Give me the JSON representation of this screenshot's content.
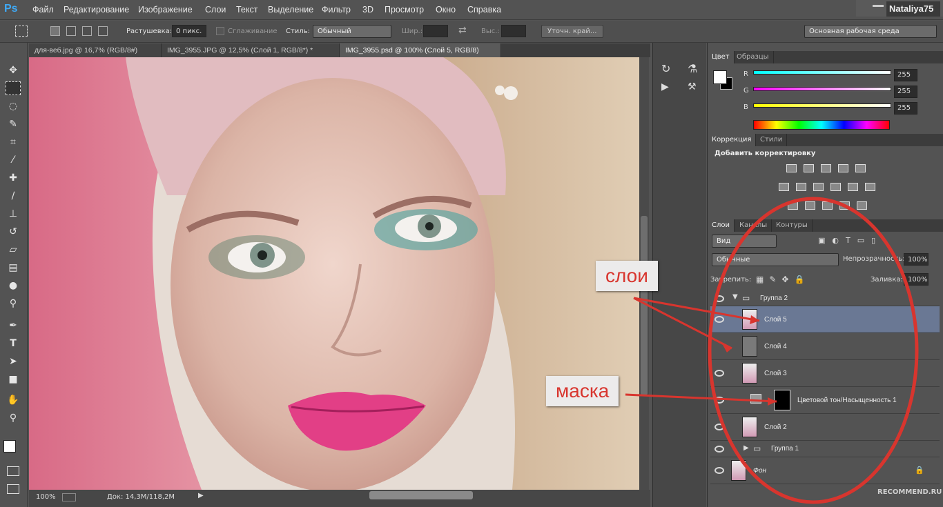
{
  "app": {
    "logo": "Ps",
    "user": "Nataliya75"
  },
  "menu": [
    "Файл",
    "Редактирование",
    "Изображение",
    "Слои",
    "Текст",
    "Выделение",
    "Фильтр",
    "3D",
    "Просмотр",
    "Окно",
    "Справка"
  ],
  "options": {
    "feather_label": "Растушевка:",
    "feather_value": "0 пикс.",
    "antialias_label": "Сглаживание",
    "style_label": "Стиль:",
    "style_value": "Обычный",
    "width_label": "Шир.:",
    "height_label": "Выс.:",
    "refine_button": "Уточн. край...",
    "workspace": "Основная рабочая среда"
  },
  "tabs": [
    {
      "label": "для-веб.jpg @ 16,7% (RGB/8#)"
    },
    {
      "label": "IMG_3955.JPG @ 12,5% (Слой 1, RGB/8*) *"
    },
    {
      "label": "IMG_3955.psd @ 100% (Слой 5, RGB/8)"
    }
  ],
  "status": {
    "zoom": "100%",
    "doc": "Док: 14,3M/118,2M"
  },
  "color_panel": {
    "tab_color": "Цвет",
    "tab_swatches": "Образцы",
    "r_label": "R",
    "g_label": "G",
    "b_label": "B",
    "r": "255",
    "g": "255",
    "b": "255"
  },
  "adjust_panel": {
    "tab_correction": "Коррекция",
    "tab_styles": "Стили",
    "heading": "Добавить корректировку"
  },
  "layers_panel": {
    "tab_layers": "Слои",
    "tab_channels": "Каналы",
    "tab_paths": "Контуры",
    "filter_label": "Вид",
    "blend_mode": "Обычные",
    "opacity_label": "Непрозрачность:",
    "opacity": "100%",
    "lock_label": "Закрепить:",
    "fill_label": "Заливка:",
    "fill": "100%",
    "layers": [
      {
        "name": "Группа 2"
      },
      {
        "name": "Слой 5"
      },
      {
        "name": "Слой 4"
      },
      {
        "name": "Слой 3"
      },
      {
        "name": "Цветовой тон/Насыщенность 1"
      },
      {
        "name": "Слой 2"
      },
      {
        "name": "Группа 1"
      },
      {
        "name": "Фон"
      }
    ]
  },
  "annotations": {
    "layers_callout": "слои",
    "mask_callout": "маска"
  },
  "watermark": "RECOMMEND.RU",
  "colors": {
    "annotation_red": "#d8352e",
    "selected_layer": "#6a7894"
  }
}
